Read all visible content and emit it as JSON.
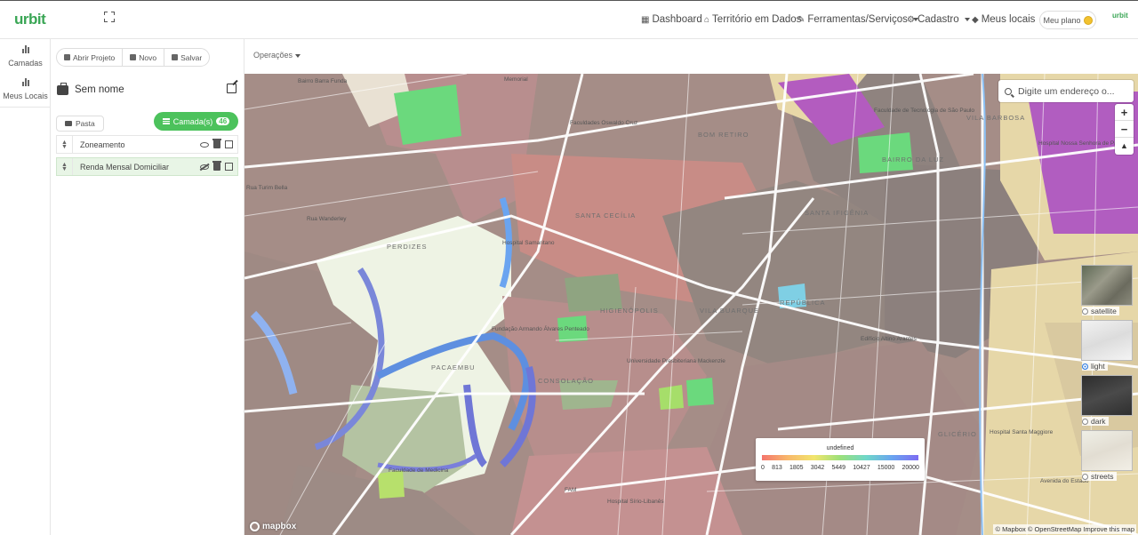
{
  "topbar": {
    "logo": "urbit",
    "nav": [
      {
        "label": "Dashboard",
        "icon": "grid-icon"
      },
      {
        "label": "Território em Dados",
        "icon": "home-icon"
      },
      {
        "label": "Ferramentas/Serviços",
        "icon": "wrench-icon"
      },
      {
        "label": "Cadastro",
        "icon": "gear-icon"
      },
      {
        "label": "Meus locais",
        "icon": "tag-icon"
      }
    ],
    "plan_label": "Meu plano",
    "avatar": "urbit"
  },
  "rail": {
    "items": [
      {
        "label": "Camadas",
        "icon": "bar-chart-icon"
      },
      {
        "label": "Meus Locais",
        "icon": "bar-chart-icon"
      }
    ]
  },
  "panel": {
    "buttons": [
      "Abrir Projeto",
      "Novo",
      "Salvar"
    ],
    "project_name": "Sem nome",
    "pasta_label": "Pasta",
    "camadas_label": "Camada(s)",
    "camadas_count": "46",
    "layers": [
      {
        "name": "Zoneamento",
        "visible": true,
        "selected": false
      },
      {
        "name": "Renda Mensal Domiciliar",
        "visible": false,
        "selected": true
      }
    ]
  },
  "operations": {
    "label": "Operações"
  },
  "map": {
    "search_placeholder": "Digite um endereço o...",
    "zoom_in": "+",
    "zoom_out": "−",
    "compass": "▲",
    "styles": [
      {
        "label": "satellite",
        "selected": false
      },
      {
        "label": "light",
        "selected": true
      },
      {
        "label": "dark",
        "selected": false
      },
      {
        "label": "streets",
        "selected": false
      }
    ],
    "legend": {
      "title": "undefined",
      "ticks": [
        "0",
        "813",
        "1805",
        "3042",
        "5449",
        "10427",
        "15000",
        "20000"
      ],
      "colors": [
        "#f4756d",
        "#f8b86b",
        "#f2e56d",
        "#9be07a",
        "#6fd7c9",
        "#6aa4f0",
        "#7d6cf2"
      ]
    },
    "attribution": "© Mapbox © OpenStreetMap Improve this map",
    "mapbox_logo": "mapbox",
    "labels": {
      "bairro_barra_funda": "Bairro Barra Funda",
      "santa_cecilia": "SANTA CECÍLIA",
      "higienopolis": "HIGIENÓPOLIS",
      "vila_buarque": "VILA BUARQUE",
      "pacaembu": "PACAEMBU",
      "consolacao": "CONSOLAÇÃO",
      "republica": "REPÚBLICA",
      "bom_retiro": "BOM RETIRO",
      "santa_ifigenia": "SANTA IFIGÊNIA",
      "bairro_da_luz": "BAIRRO DA LUZ",
      "glicerio": "GLICÉRIO",
      "perdizes": "PERDIZES",
      "vila_barbosa": "VILA BARBOSA",
      "memorial": "Memorial",
      "fac_oswaldo": "Faculdades Oswaldo Cruz",
      "fac_tec": "Faculdade de Tecnologia de São Paulo",
      "hosp_samaritano": "Hospital Samaritano",
      "fundacao": "Fundação Armando Álvares Penteado",
      "mackenzie": "Universidade Presbiteriana Mackenzie",
      "medicina": "Faculdade de Medicina",
      "fam": "FAM",
      "sirio": "Hospital Sírio-Libanês",
      "santa_maggiore": "Hospital Santa Maggiore",
      "nossa_senhora": "Hospital Nossa Senhora de Paz",
      "edificio": "Edifício Altino Arantes",
      "avenida_estado": "Avenida do Estado",
      "rua_turim": "Rua Turim Bella",
      "rua_wanderley": "Rua Wanderley"
    }
  }
}
